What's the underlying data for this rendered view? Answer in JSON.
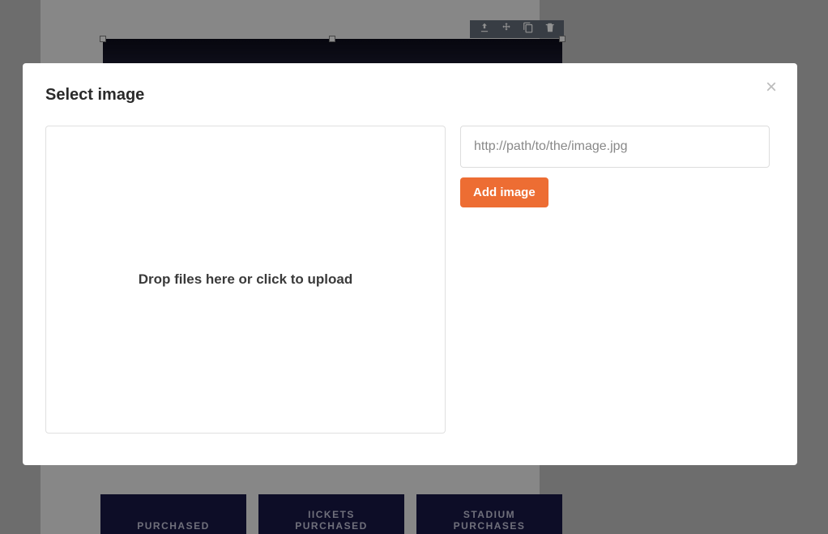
{
  "modal": {
    "title": "Select image",
    "drop_zone_text": "Drop files here or click to upload",
    "url_placeholder": "http://path/to/the/image.jpg",
    "add_button_label": "Add image"
  },
  "background": {
    "toolbar_icons": [
      "upload",
      "move",
      "copy",
      "delete"
    ],
    "cards": [
      {
        "line1": "PURCHASED"
      },
      {
        "line1": "IICKETS",
        "line2": "PURCHASED"
      },
      {
        "line1": "STADIUM",
        "line2": "PURCHASES"
      }
    ]
  }
}
